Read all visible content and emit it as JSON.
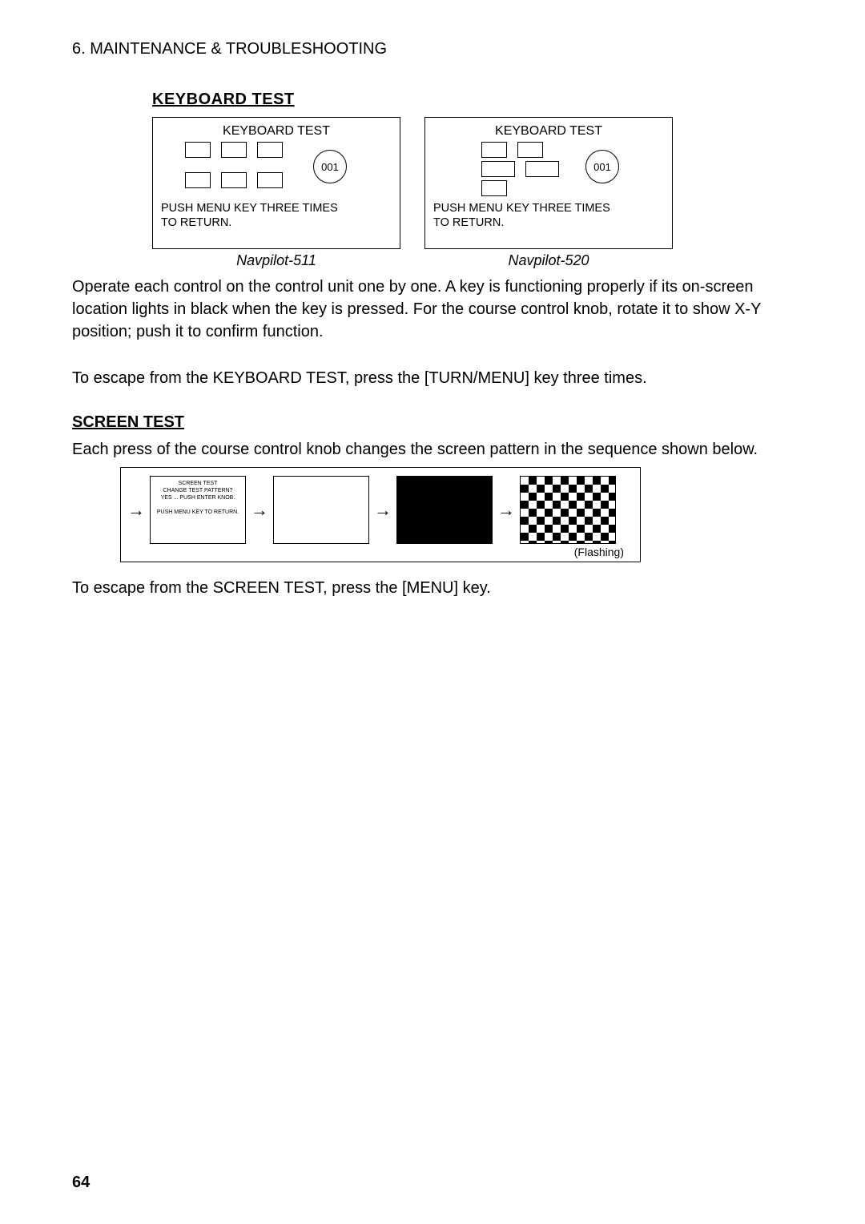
{
  "header": "6. MAINTENANCE & TROUBLESHOOTING",
  "keyboard_section_title": "KEYBOARD TEST",
  "kb_panel_title": "KEYBOARD TEST",
  "kb_knob_value": "001",
  "kb_instr_line1": "PUSH MENU KEY THREE TIMES",
  "kb_instr_line2": "TO RETURN.",
  "kb_caption_left": "Navpilot-511",
  "kb_caption_right": "Navpilot-520",
  "kb_paragraph": "Operate each control on the control unit one by one. A key is functioning properly if its on-screen location lights in black when the key is pressed. For the course control knob, rotate it to show X-Y position; push it to confirm function.",
  "kb_escape": "To escape from the KEYBOARD TEST, press the [TURN/MENU] key three times.",
  "screen_section_title": "SCREEN TEST",
  "screen_intro": "Each press of the course control knob changes the screen pattern in the sequence shown below.",
  "screen_box_line1": "SCREEN TEST",
  "screen_box_line2": "CHANGE TEST PATTERN?",
  "screen_box_line3": "YES ... PUSH ENTER KNOB.",
  "screen_box_line4": "PUSH MENU KEY TO RETURN.",
  "flashing": "(Flashing)",
  "screen_escape": "To escape from the SCREEN TEST, press the [MENU] key.",
  "page_number": "64"
}
